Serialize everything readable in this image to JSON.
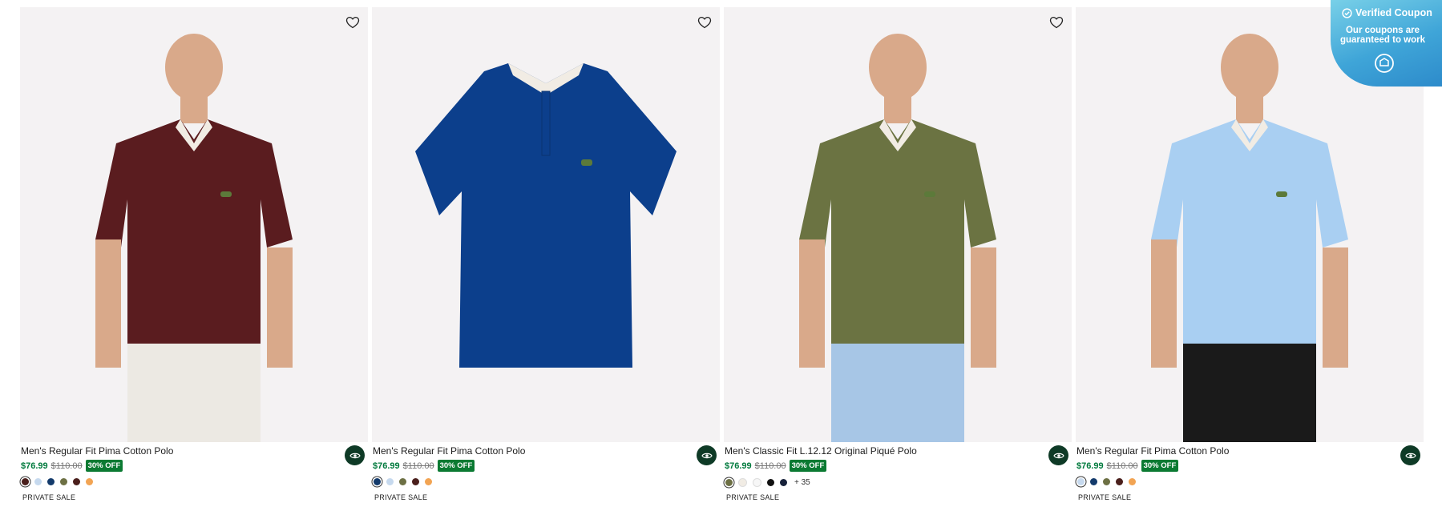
{
  "products": [
    {
      "name": "Men's Regular Fit Pima Cotton Polo",
      "sale_price": "$76.99",
      "original_price": "$110.00",
      "discount_badge": "30% OFF",
      "swatches": [
        "#4a1f1c",
        "#c6d9ee",
        "#133a6b",
        "#6d7044",
        "#4a1f1c",
        "#f2a453"
      ],
      "selected_swatch": 0,
      "more_colors": "",
      "tag": "PRIVATE SALE",
      "image_alt": "burgundy polo on model",
      "polo_color": "#5a1c1f"
    },
    {
      "name": "Men's Regular Fit Pima Cotton Polo",
      "sale_price": "$76.99",
      "original_price": "$110.00",
      "discount_badge": "30% OFF",
      "swatches": [
        "#133a6b",
        "#c6d9ee",
        "#6d7044",
        "#4a1f1c",
        "#f2a453"
      ],
      "selected_swatch": 0,
      "more_colors": "",
      "tag": "PRIVATE SALE",
      "image_alt": "navy polo flat lay",
      "polo_color": "#0c3f8c"
    },
    {
      "name": "Men's Classic Fit L.12.12 Original Piqué Polo",
      "sale_price": "$76.99",
      "original_price": "$110.00",
      "discount_badge": "30% OFF",
      "swatches": [
        "#6d7044",
        "#f1ece4",
        "#f7f7f7",
        "#111111",
        "#17213a"
      ],
      "selected_swatch": 0,
      "more_colors": "+ 35",
      "tag": "PRIVATE SALE",
      "image_alt": "olive polo on model",
      "polo_color": "#6b7342"
    },
    {
      "name": "Men's Regular Fit Pima Cotton Polo",
      "sale_price": "$76.99",
      "original_price": "$110.00",
      "discount_badge": "30% OFF",
      "swatches": [
        "#c6d9ee",
        "#133a6b",
        "#6d7044",
        "#4a1f1c",
        "#f2a453"
      ],
      "selected_swatch": 0,
      "more_colors": "",
      "tag": "PRIVATE SALE",
      "image_alt": "light blue polo on model",
      "polo_color": "#a9cff2"
    }
  ],
  "coupon": {
    "title": "Verified Coupon",
    "subtitle": "Our coupons are guaranteed to work",
    "icon": "chat-bubble-icon"
  },
  "icons": {
    "wishlist": "heart-outline-icon",
    "quick_view": "eye-icon",
    "verified": "check-circle-icon"
  },
  "colors": {
    "accent_green": "#007a3d",
    "badge_green": "#0b7a32",
    "quick_view_bg": "#0e3a26"
  }
}
